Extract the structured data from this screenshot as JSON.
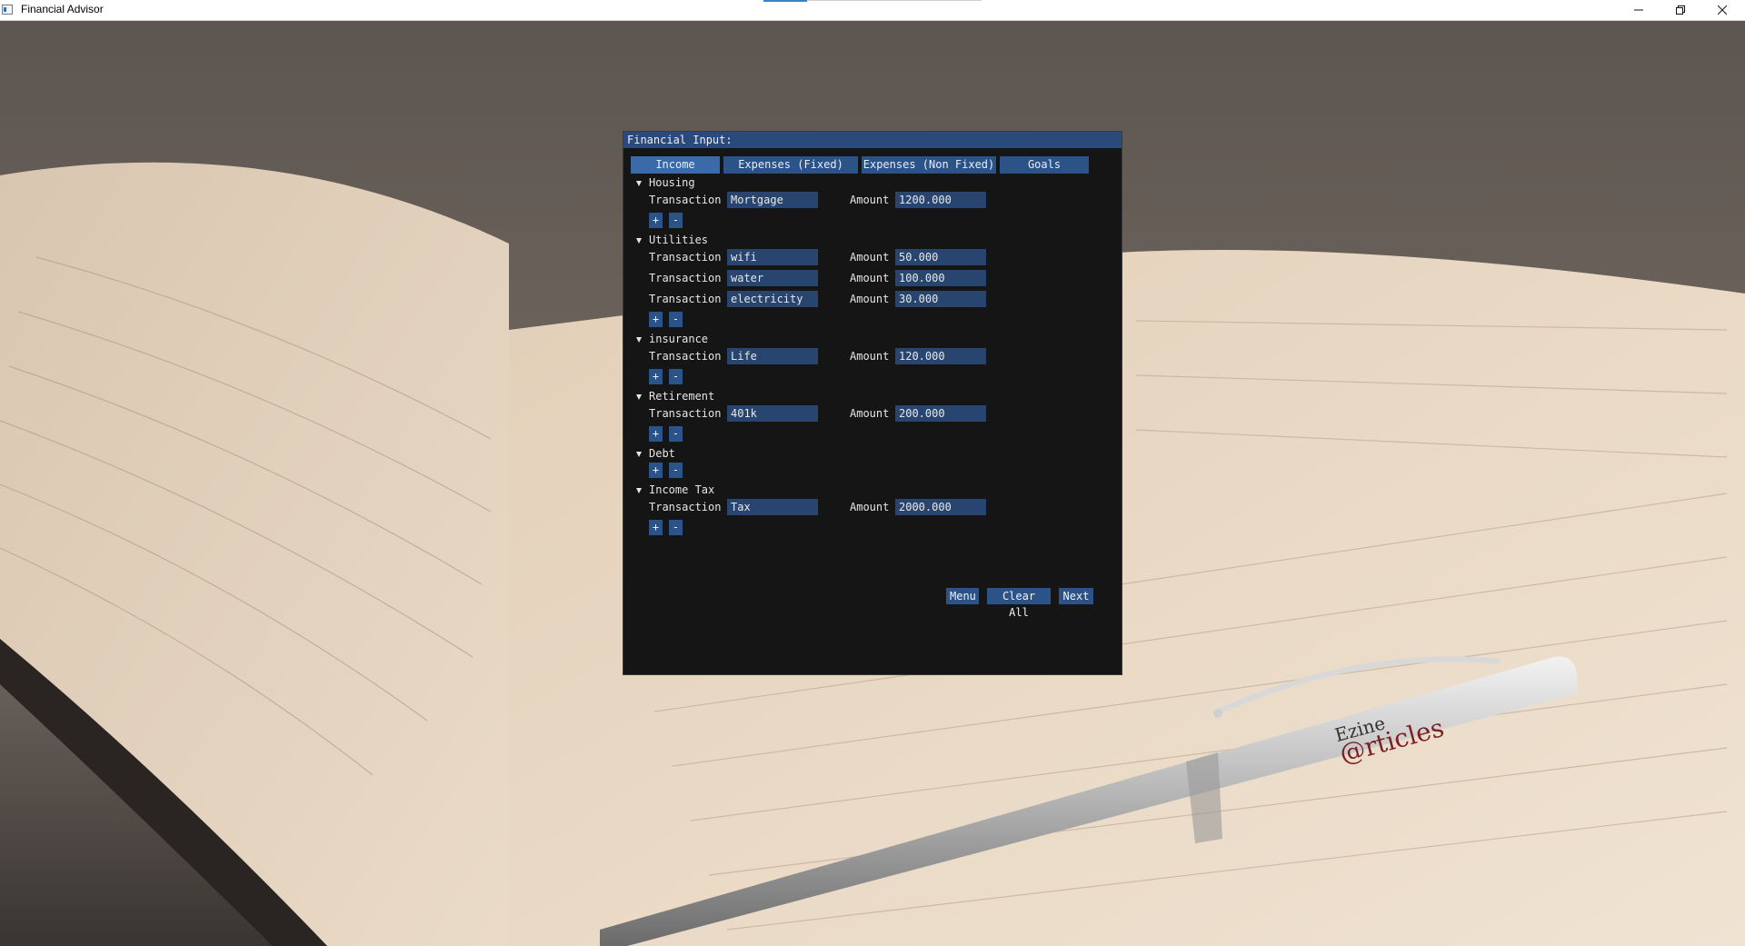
{
  "window": {
    "title": "Financial Advisor",
    "icon": "app-window-icon",
    "controls": [
      "minimize-icon",
      "restore-icon",
      "close-icon"
    ]
  },
  "panel": {
    "title": "Financial Input:",
    "tabs": [
      {
        "label": "Income"
      },
      {
        "label": "Expenses (Fixed)"
      },
      {
        "label": "Expenses (Non Fixed)"
      },
      {
        "label": "Goals"
      }
    ],
    "transaction_label": "Transaction",
    "amount_label": "Amount",
    "add_label": "+",
    "remove_label": "-",
    "sections": [
      {
        "name": "Housing",
        "rows": [
          {
            "transaction": "Mortgage",
            "amount": "1200.000"
          }
        ]
      },
      {
        "name": "Utilities",
        "rows": [
          {
            "transaction": "wifi",
            "amount": "50.000"
          },
          {
            "transaction": "water",
            "amount": "100.000"
          },
          {
            "transaction": "electricity",
            "amount": "30.000"
          }
        ]
      },
      {
        "name": "insurance",
        "rows": [
          {
            "transaction": "Life",
            "amount": "120.000"
          }
        ]
      },
      {
        "name": "Retirement",
        "rows": [
          {
            "transaction": "401k",
            "amount": "200.000"
          }
        ]
      },
      {
        "name": "Debt",
        "rows": []
      },
      {
        "name": "Income Tax",
        "rows": [
          {
            "transaction": "Tax",
            "amount": "2000.000"
          }
        ]
      }
    ],
    "buttons": {
      "menu": "Menu",
      "clear_all": "Clear All",
      "next": "Next"
    }
  },
  "background": {
    "pen_brand_line1": "Ezine",
    "pen_brand_line2": "@rticles"
  },
  "colors": {
    "panel_bg": "#151515",
    "header": "#294a7a",
    "button": "#2c5387",
    "input": "#27456e"
  }
}
